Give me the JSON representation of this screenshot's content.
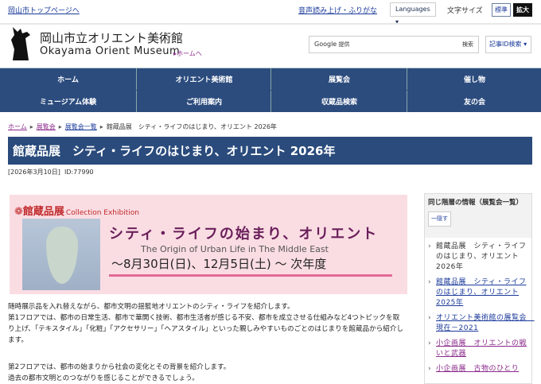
{
  "topbar": {
    "city_link": "岡山市トップページへ",
    "voice": "音声読み上げ・ふりがな",
    "languages": "Languages",
    "font_size_label": "文字サイズ",
    "standard": "標準",
    "enlarge": "拡大"
  },
  "header": {
    "title_jp": "岡山市立オリエント美術館",
    "title_en": "Okayama Orient Museum",
    "home_link": "ホームへ",
    "search_brand": "Google",
    "search_sub": "提供",
    "search_button": "検索",
    "id_search": "記事ID検索"
  },
  "nav": [
    "ホーム",
    "オリエント美術館",
    "展覧会",
    "催し物",
    "ミュージアム体験",
    "ご利用案内",
    "収蔵品検索",
    "友の会"
  ],
  "breadcrumb": {
    "items": [
      "ホーム",
      "展覧会",
      "展覧会一覧"
    ],
    "current": "館蔵品展　シティ・ライフのはじまり、オリエント 2026年"
  },
  "page": {
    "title": "館蔵品展　シティ・ライフのはじまり、オリエント 2026年",
    "date": "[2026年3月10日]",
    "id": "ID:77990"
  },
  "banner": {
    "label": "館蔵品展",
    "label_en": "Collection Exhibition",
    "title": "シティ・ライフの始まり、オリエント",
    "subtitle": "The Origin of Urban Life in The Middle East",
    "dates": "～8月30日(日)、12月5日(土) ～ 次年度"
  },
  "body": {
    "p1": "随時展示品を入れ替えながら、都市文明の揺籃地オリエントのシティ・ライフを紹介します。",
    "p2": "第1フロアでは、都市の日常生活、都市で華開く技術、都市生活者が感じる不安、都市を成立させる仕組みなど4つトピックを取り上げ、「テキスタイル」「化粧」「アクセサリー」「ヘアスタイル」といった親しみやすいものごとのはじまりを館蔵品から紹介します。",
    "p3": "第2フロアでは、都市の始まりから社会の変化とその背景を紹介します。",
    "p4": "過去の都市文明とのつながりを感じることができるでしょう。"
  },
  "sidebar": {
    "heading": "同じ階層の情報（展覧会一覧）",
    "hide": "一隠す",
    "items": [
      "館蔵品展　シティ・ライフのはじまり、オリエント 2026年",
      "館蔵品展　シティ・ライフのはじまり、オリエント 2025年",
      "オリエント美術館の展覧会　現在－2021",
      "小企画展　オリエントの戦いと武器",
      "小企画展　古物のひとり"
    ]
  }
}
